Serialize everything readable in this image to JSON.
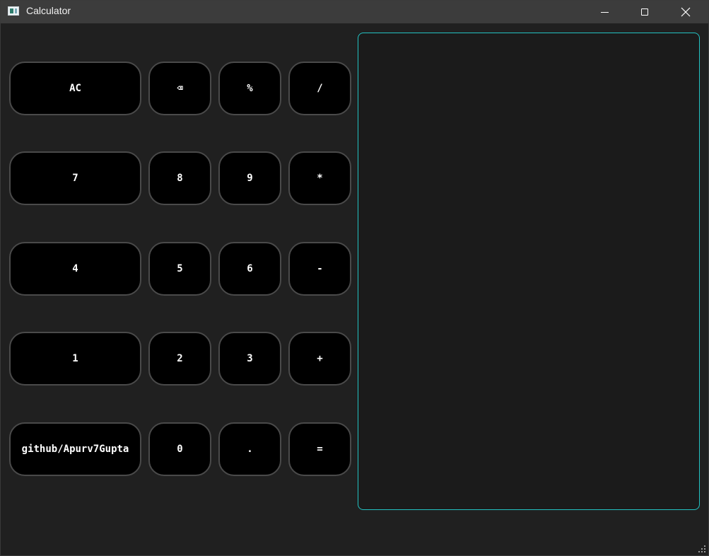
{
  "window": {
    "title": "Calculator"
  },
  "keypad": {
    "rows": [
      [
        "AC",
        "⌫",
        "%",
        "/"
      ],
      [
        "7",
        "8",
        "9",
        "*"
      ],
      [
        "4",
        "5",
        "6",
        "-"
      ],
      [
        "1",
        "2",
        "3",
        "+"
      ],
      [
        "github/Apurv7Gupta",
        "0",
        ".",
        "="
      ]
    ]
  },
  "display": {
    "value": ""
  },
  "colors": {
    "background": "#202020",
    "titlebar": "#3c3c3c",
    "button_fill": "#000000",
    "button_border": "#4a4a4a",
    "display_border": "#23c2c2"
  }
}
